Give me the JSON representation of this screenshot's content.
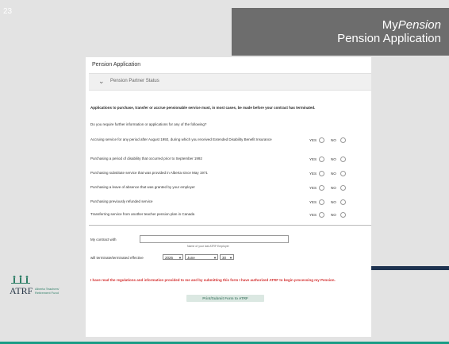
{
  "slide": {
    "number": "23"
  },
  "header": {
    "title_prefix": "My",
    "title_italic": "Pension",
    "subtitle": "Pension Application"
  },
  "form": {
    "title": "Pension Application",
    "accordion_label": "Pension Partner Status",
    "intro": "Applications to purchase, transfer or accrue pensionable service must, in most cases, be made before your contract has terminated.",
    "question": "Do you require further information or applications for any of the following?",
    "yes_label": "YES",
    "no_label": "NO",
    "options": [
      {
        "label": "Accruing service for any period after August 1992, during which you received Extended Disability Benefit Insurance"
      },
      {
        "label": "Purchasing a period of disability that occurred prior to September 1992"
      },
      {
        "label": "Purchasing substitute service that was provided in Alberta since May 1971"
      },
      {
        "label": "Purchasing a leave of absence that was granted by your employer"
      },
      {
        "label": "Purchasing previously refunded service"
      },
      {
        "label": "Transferring service from another teacher pension plan in Canada"
      }
    ],
    "contract_label": "My contract with",
    "contract_value": "",
    "contract_hint": "Name of your last ATRF Employer",
    "terminate_label": "will terminate/terminated effective",
    "year": "2026",
    "month": "June",
    "day": "30",
    "disclaimer": "I have read the regulations and information provided to me and by submitting this form I have authorized ATRF to begin processing my Pension.",
    "submit_label": "Print/Submit Form to ATRF"
  },
  "logo": {
    "name": "ATRF",
    "line1": "Alberta Teachers'",
    "line2": "Retirement Fund"
  },
  "colors": {
    "teal": "#1a9c85",
    "navy": "#1e3350",
    "header_bg": "#6d6d6d",
    "disclaimer_red": "#d32f2f"
  }
}
